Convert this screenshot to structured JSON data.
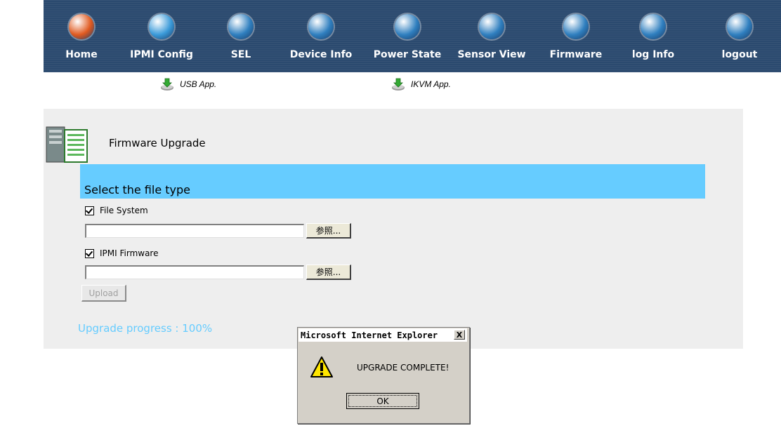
{
  "nav": {
    "items": [
      {
        "label": "Home",
        "icon": "home-icon",
        "color": "#e05a20"
      },
      {
        "label": "IPMI Config",
        "icon": "config-icon",
        "color": "#3a9ad9"
      },
      {
        "label": "SEL",
        "icon": "books-icon",
        "color": "#2f7fbf"
      },
      {
        "label": "Device Info",
        "icon": "device-icon",
        "color": "#2f7fbf"
      },
      {
        "label": "Power State",
        "icon": "power-icon",
        "color": "#2f7fbf"
      },
      {
        "label": "Sensor View",
        "icon": "sensor-icon",
        "color": "#2f7fbf"
      },
      {
        "label": "Firmware",
        "icon": "firmware-icon",
        "color": "#2f7fbf"
      },
      {
        "label": "log Info",
        "icon": "log-icon",
        "color": "#2f7fbf"
      },
      {
        "label": "logout",
        "icon": "logout-icon",
        "color": "#2f7fbf"
      }
    ],
    "background": "#2b4a6f"
  },
  "apps": {
    "usb_label": "USB App.",
    "ikvm_label": "IKVM App."
  },
  "panel": {
    "title": "Firmware Upgrade",
    "section_heading": "Select the file type",
    "file_system_label": "File System",
    "file_system_checked": true,
    "file_system_value": "",
    "ipmi_firmware_label": "IPMI Firmware",
    "ipmi_firmware_checked": true,
    "ipmi_firmware_value": "",
    "browse_label": "参照...",
    "upload_label": "Upload",
    "progress_text": "Upgrade progress : 100%",
    "progress_value": 100
  },
  "dialog": {
    "title": "Microsoft Internet Explorer",
    "close_label": "X",
    "message": "UPGRADE COMPLETE!",
    "ok_label": "OK"
  },
  "colors": {
    "accent_bar": "#66ccff",
    "panel_bg": "#eeeeee",
    "progress_text": "#66ccff"
  }
}
